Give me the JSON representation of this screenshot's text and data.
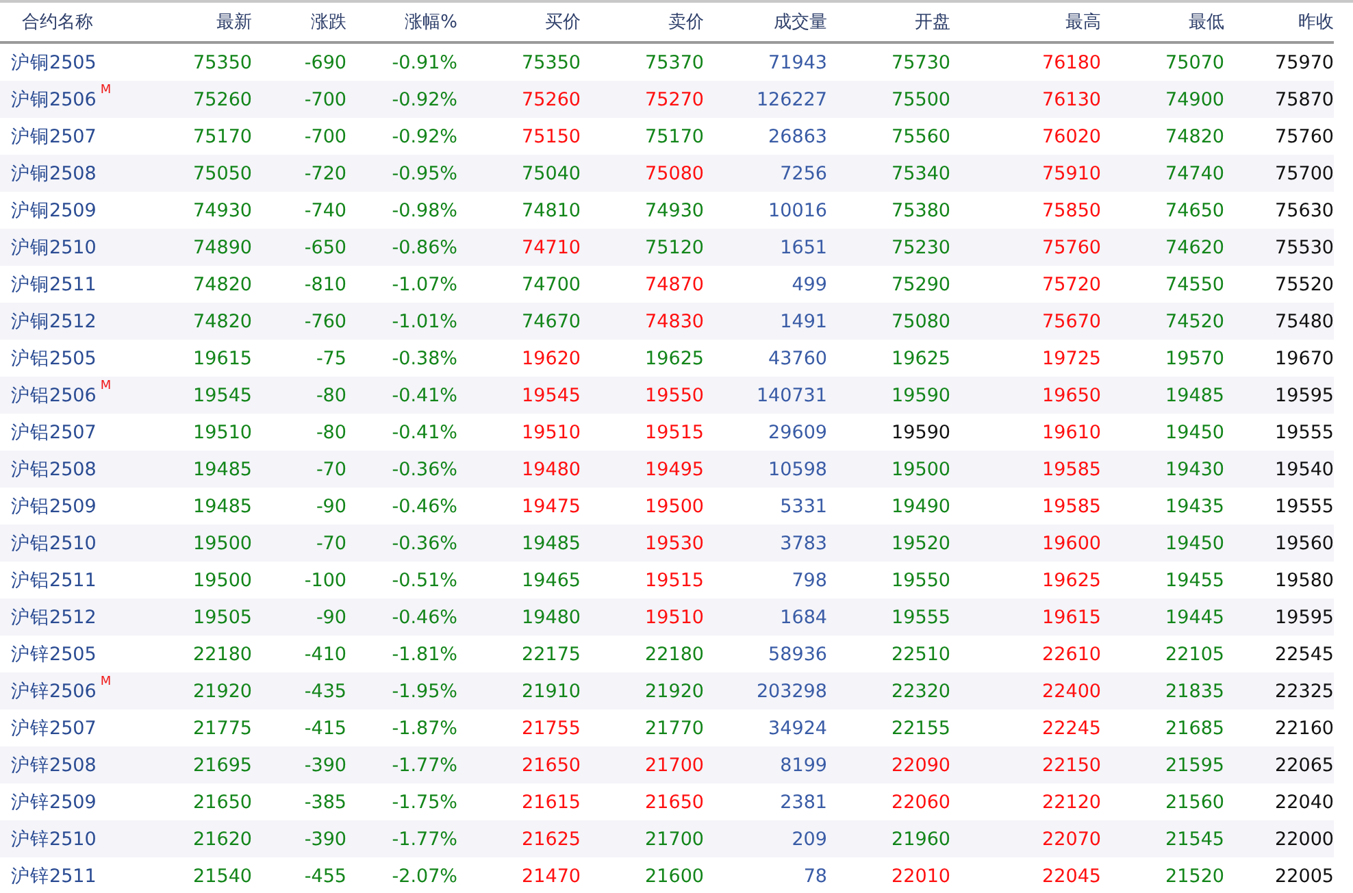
{
  "columns": [
    "合约名称",
    "最新",
    "涨跌",
    "涨幅%",
    "买价",
    "卖价",
    "成交量",
    "开盘",
    "最高",
    "最低",
    "昨收"
  ],
  "rows": [
    {
      "contract": "沪铜2505",
      "last": {
        "text": "75350",
        "color": "#13851a"
      },
      "change": {
        "text": "-690",
        "color": "#13851a"
      },
      "change_pct": {
        "text": "-0.91%",
        "color": "#13851a"
      },
      "bid": {
        "text": "75350",
        "color": "#13851a"
      },
      "ask": {
        "text": "75370",
        "color": "#13851a"
      },
      "volume": "71943",
      "open": {
        "text": "75730",
        "color": "#13851a"
      },
      "high": {
        "text": "76180",
        "color": "#ff1010"
      },
      "low": {
        "text": "75070",
        "color": "#13851a"
      },
      "prev_close": "75970"
    },
    {
      "contract": "沪铜2506",
      "badge": "M",
      "last": {
        "text": "75260",
        "color": "#13851a"
      },
      "change": {
        "text": "-700",
        "color": "#13851a"
      },
      "change_pct": {
        "text": "-0.92%",
        "color": "#13851a"
      },
      "bid": {
        "text": "75260",
        "color": "#ff1010"
      },
      "ask": {
        "text": "75270",
        "color": "#ff1010"
      },
      "volume": "126227",
      "open": {
        "text": "75500",
        "color": "#13851a"
      },
      "high": {
        "text": "76130",
        "color": "#ff1010"
      },
      "low": {
        "text": "74900",
        "color": "#13851a"
      },
      "prev_close": "75870"
    },
    {
      "contract": "沪铜2507",
      "last": {
        "text": "75170",
        "color": "#13851a"
      },
      "change": {
        "text": "-700",
        "color": "#13851a"
      },
      "change_pct": {
        "text": "-0.92%",
        "color": "#13851a"
      },
      "bid": {
        "text": "75150",
        "color": "#ff1010"
      },
      "ask": {
        "text": "75170",
        "color": "#13851a"
      },
      "volume": "26863",
      "open": {
        "text": "75560",
        "color": "#13851a"
      },
      "high": {
        "text": "76020",
        "color": "#ff1010"
      },
      "low": {
        "text": "74820",
        "color": "#13851a"
      },
      "prev_close": "75760"
    },
    {
      "contract": "沪铜2508",
      "last": {
        "text": "75050",
        "color": "#13851a"
      },
      "change": {
        "text": "-720",
        "color": "#13851a"
      },
      "change_pct": {
        "text": "-0.95%",
        "color": "#13851a"
      },
      "bid": {
        "text": "75040",
        "color": "#13851a"
      },
      "ask": {
        "text": "75080",
        "color": "#ff1010"
      },
      "volume": "7256",
      "open": {
        "text": "75340",
        "color": "#13851a"
      },
      "high": {
        "text": "75910",
        "color": "#ff1010"
      },
      "low": {
        "text": "74740",
        "color": "#13851a"
      },
      "prev_close": "75700"
    },
    {
      "contract": "沪铜2509",
      "last": {
        "text": "74930",
        "color": "#13851a"
      },
      "change": {
        "text": "-740",
        "color": "#13851a"
      },
      "change_pct": {
        "text": "-0.98%",
        "color": "#13851a"
      },
      "bid": {
        "text": "74810",
        "color": "#13851a"
      },
      "ask": {
        "text": "74930",
        "color": "#13851a"
      },
      "volume": "10016",
      "open": {
        "text": "75380",
        "color": "#13851a"
      },
      "high": {
        "text": "75850",
        "color": "#ff1010"
      },
      "low": {
        "text": "74650",
        "color": "#13851a"
      },
      "prev_close": "75630"
    },
    {
      "contract": "沪铜2510",
      "last": {
        "text": "74890",
        "color": "#13851a"
      },
      "change": {
        "text": "-650",
        "color": "#13851a"
      },
      "change_pct": {
        "text": "-0.86%",
        "color": "#13851a"
      },
      "bid": {
        "text": "74710",
        "color": "#ff1010"
      },
      "ask": {
        "text": "75120",
        "color": "#13851a"
      },
      "volume": "1651",
      "open": {
        "text": "75230",
        "color": "#13851a"
      },
      "high": {
        "text": "75760",
        "color": "#ff1010"
      },
      "low": {
        "text": "74620",
        "color": "#13851a"
      },
      "prev_close": "75530"
    },
    {
      "contract": "沪铜2511",
      "last": {
        "text": "74820",
        "color": "#13851a"
      },
      "change": {
        "text": "-810",
        "color": "#13851a"
      },
      "change_pct": {
        "text": "-1.07%",
        "color": "#13851a"
      },
      "bid": {
        "text": "74700",
        "color": "#13851a"
      },
      "ask": {
        "text": "74870",
        "color": "#ff1010"
      },
      "volume": "499",
      "open": {
        "text": "75290",
        "color": "#13851a"
      },
      "high": {
        "text": "75720",
        "color": "#ff1010"
      },
      "low": {
        "text": "74550",
        "color": "#13851a"
      },
      "prev_close": "75520"
    },
    {
      "contract": "沪铜2512",
      "last": {
        "text": "74820",
        "color": "#13851a"
      },
      "change": {
        "text": "-760",
        "color": "#13851a"
      },
      "change_pct": {
        "text": "-1.01%",
        "color": "#13851a"
      },
      "bid": {
        "text": "74670",
        "color": "#13851a"
      },
      "ask": {
        "text": "74830",
        "color": "#ff1010"
      },
      "volume": "1491",
      "open": {
        "text": "75080",
        "color": "#13851a"
      },
      "high": {
        "text": "75670",
        "color": "#ff1010"
      },
      "low": {
        "text": "74520",
        "color": "#13851a"
      },
      "prev_close": "75480"
    },
    {
      "contract": "沪铝2505",
      "last": {
        "text": "19615",
        "color": "#13851a"
      },
      "change": {
        "text": "-75",
        "color": "#13851a"
      },
      "change_pct": {
        "text": "-0.38%",
        "color": "#13851a"
      },
      "bid": {
        "text": "19620",
        "color": "#ff1010"
      },
      "ask": {
        "text": "19625",
        "color": "#13851a"
      },
      "volume": "43760",
      "open": {
        "text": "19625",
        "color": "#13851a"
      },
      "high": {
        "text": "19725",
        "color": "#ff1010"
      },
      "low": {
        "text": "19570",
        "color": "#13851a"
      },
      "prev_close": "19670"
    },
    {
      "contract": "沪铝2506",
      "badge": "M",
      "last": {
        "text": "19545",
        "color": "#13851a"
      },
      "change": {
        "text": "-80",
        "color": "#13851a"
      },
      "change_pct": {
        "text": "-0.41%",
        "color": "#13851a"
      },
      "bid": {
        "text": "19545",
        "color": "#ff1010"
      },
      "ask": {
        "text": "19550",
        "color": "#ff1010"
      },
      "volume": "140731",
      "open": {
        "text": "19590",
        "color": "#13851a"
      },
      "high": {
        "text": "19650",
        "color": "#ff1010"
      },
      "low": {
        "text": "19485",
        "color": "#13851a"
      },
      "prev_close": "19595"
    },
    {
      "contract": "沪铝2507",
      "last": {
        "text": "19510",
        "color": "#13851a"
      },
      "change": {
        "text": "-80",
        "color": "#13851a"
      },
      "change_pct": {
        "text": "-0.41%",
        "color": "#13851a"
      },
      "bid": {
        "text": "19510",
        "color": "#ff1010"
      },
      "ask": {
        "text": "19515",
        "color": "#ff1010"
      },
      "volume": "29609",
      "open": {
        "text": "19590",
        "color": "#111111"
      },
      "high": {
        "text": "19610",
        "color": "#ff1010"
      },
      "low": {
        "text": "19450",
        "color": "#13851a"
      },
      "prev_close": "19555"
    },
    {
      "contract": "沪铝2508",
      "last": {
        "text": "19485",
        "color": "#13851a"
      },
      "change": {
        "text": "-70",
        "color": "#13851a"
      },
      "change_pct": {
        "text": "-0.36%",
        "color": "#13851a"
      },
      "bid": {
        "text": "19480",
        "color": "#ff1010"
      },
      "ask": {
        "text": "19495",
        "color": "#ff1010"
      },
      "volume": "10598",
      "open": {
        "text": "19500",
        "color": "#13851a"
      },
      "high": {
        "text": "19585",
        "color": "#ff1010"
      },
      "low": {
        "text": "19430",
        "color": "#13851a"
      },
      "prev_close": "19540"
    },
    {
      "contract": "沪铝2509",
      "last": {
        "text": "19485",
        "color": "#13851a"
      },
      "change": {
        "text": "-90",
        "color": "#13851a"
      },
      "change_pct": {
        "text": "-0.46%",
        "color": "#13851a"
      },
      "bid": {
        "text": "19475",
        "color": "#ff1010"
      },
      "ask": {
        "text": "19500",
        "color": "#ff1010"
      },
      "volume": "5331",
      "open": {
        "text": "19490",
        "color": "#13851a"
      },
      "high": {
        "text": "19585",
        "color": "#ff1010"
      },
      "low": {
        "text": "19435",
        "color": "#13851a"
      },
      "prev_close": "19555"
    },
    {
      "contract": "沪铝2510",
      "last": {
        "text": "19500",
        "color": "#13851a"
      },
      "change": {
        "text": "-70",
        "color": "#13851a"
      },
      "change_pct": {
        "text": "-0.36%",
        "color": "#13851a"
      },
      "bid": {
        "text": "19485",
        "color": "#13851a"
      },
      "ask": {
        "text": "19530",
        "color": "#ff1010"
      },
      "volume": "3783",
      "open": {
        "text": "19520",
        "color": "#13851a"
      },
      "high": {
        "text": "19600",
        "color": "#ff1010"
      },
      "low": {
        "text": "19450",
        "color": "#13851a"
      },
      "prev_close": "19560"
    },
    {
      "contract": "沪铝2511",
      "last": {
        "text": "19500",
        "color": "#13851a"
      },
      "change": {
        "text": "-100",
        "color": "#13851a"
      },
      "change_pct": {
        "text": "-0.51%",
        "color": "#13851a"
      },
      "bid": {
        "text": "19465",
        "color": "#13851a"
      },
      "ask": {
        "text": "19515",
        "color": "#ff1010"
      },
      "volume": "798",
      "open": {
        "text": "19550",
        "color": "#13851a"
      },
      "high": {
        "text": "19625",
        "color": "#ff1010"
      },
      "low": {
        "text": "19455",
        "color": "#13851a"
      },
      "prev_close": "19580"
    },
    {
      "contract": "沪铝2512",
      "last": {
        "text": "19505",
        "color": "#13851a"
      },
      "change": {
        "text": "-90",
        "color": "#13851a"
      },
      "change_pct": {
        "text": "-0.46%",
        "color": "#13851a"
      },
      "bid": {
        "text": "19480",
        "color": "#13851a"
      },
      "ask": {
        "text": "19510",
        "color": "#ff1010"
      },
      "volume": "1684",
      "open": {
        "text": "19555",
        "color": "#13851a"
      },
      "high": {
        "text": "19615",
        "color": "#ff1010"
      },
      "low": {
        "text": "19445",
        "color": "#13851a"
      },
      "prev_close": "19595"
    },
    {
      "contract": "沪锌2505",
      "last": {
        "text": "22180",
        "color": "#13851a"
      },
      "change": {
        "text": "-410",
        "color": "#13851a"
      },
      "change_pct": {
        "text": "-1.81%",
        "color": "#13851a"
      },
      "bid": {
        "text": "22175",
        "color": "#13851a"
      },
      "ask": {
        "text": "22180",
        "color": "#13851a"
      },
      "volume": "58936",
      "open": {
        "text": "22510",
        "color": "#13851a"
      },
      "high": {
        "text": "22610",
        "color": "#ff1010"
      },
      "low": {
        "text": "22105",
        "color": "#13851a"
      },
      "prev_close": "22545"
    },
    {
      "contract": "沪锌2506",
      "badge": "M",
      "last": {
        "text": "21920",
        "color": "#13851a"
      },
      "change": {
        "text": "-435",
        "color": "#13851a"
      },
      "change_pct": {
        "text": "-1.95%",
        "color": "#13851a"
      },
      "bid": {
        "text": "21910",
        "color": "#13851a"
      },
      "ask": {
        "text": "21920",
        "color": "#13851a"
      },
      "volume": "203298",
      "open": {
        "text": "22320",
        "color": "#13851a"
      },
      "high": {
        "text": "22400",
        "color": "#ff1010"
      },
      "low": {
        "text": "21835",
        "color": "#13851a"
      },
      "prev_close": "22325"
    },
    {
      "contract": "沪锌2507",
      "last": {
        "text": "21775",
        "color": "#13851a"
      },
      "change": {
        "text": "-415",
        "color": "#13851a"
      },
      "change_pct": {
        "text": "-1.87%",
        "color": "#13851a"
      },
      "bid": {
        "text": "21755",
        "color": "#ff1010"
      },
      "ask": {
        "text": "21770",
        "color": "#13851a"
      },
      "volume": "34924",
      "open": {
        "text": "22155",
        "color": "#13851a"
      },
      "high": {
        "text": "22245",
        "color": "#ff1010"
      },
      "low": {
        "text": "21685",
        "color": "#13851a"
      },
      "prev_close": "22160"
    },
    {
      "contract": "沪锌2508",
      "last": {
        "text": "21695",
        "color": "#13851a"
      },
      "change": {
        "text": "-390",
        "color": "#13851a"
      },
      "change_pct": {
        "text": "-1.77%",
        "color": "#13851a"
      },
      "bid": {
        "text": "21650",
        "color": "#ff1010"
      },
      "ask": {
        "text": "21700",
        "color": "#ff1010"
      },
      "volume": "8199",
      "open": {
        "text": "22090",
        "color": "#ff1010"
      },
      "high": {
        "text": "22150",
        "color": "#ff1010"
      },
      "low": {
        "text": "21595",
        "color": "#13851a"
      },
      "prev_close": "22065"
    },
    {
      "contract": "沪锌2509",
      "last": {
        "text": "21650",
        "color": "#13851a"
      },
      "change": {
        "text": "-385",
        "color": "#13851a"
      },
      "change_pct": {
        "text": "-1.75%",
        "color": "#13851a"
      },
      "bid": {
        "text": "21615",
        "color": "#ff1010"
      },
      "ask": {
        "text": "21650",
        "color": "#ff1010"
      },
      "volume": "2381",
      "open": {
        "text": "22060",
        "color": "#ff1010"
      },
      "high": {
        "text": "22120",
        "color": "#ff1010"
      },
      "low": {
        "text": "21560",
        "color": "#13851a"
      },
      "prev_close": "22040"
    },
    {
      "contract": "沪锌2510",
      "last": {
        "text": "21620",
        "color": "#13851a"
      },
      "change": {
        "text": "-390",
        "color": "#13851a"
      },
      "change_pct": {
        "text": "-1.77%",
        "color": "#13851a"
      },
      "bid": {
        "text": "21625",
        "color": "#ff1010"
      },
      "ask": {
        "text": "21700",
        "color": "#13851a"
      },
      "volume": "209",
      "open": {
        "text": "21960",
        "color": "#13851a"
      },
      "high": {
        "text": "22070",
        "color": "#ff1010"
      },
      "low": {
        "text": "21545",
        "color": "#13851a"
      },
      "prev_close": "22000"
    },
    {
      "contract": "沪锌2511",
      "last": {
        "text": "21540",
        "color": "#13851a"
      },
      "change": {
        "text": "-455",
        "color": "#13851a"
      },
      "change_pct": {
        "text": "-2.07%",
        "color": "#13851a"
      },
      "bid": {
        "text": "21470",
        "color": "#ff1010"
      },
      "ask": {
        "text": "21600",
        "color": "#13851a"
      },
      "volume": "78",
      "open": {
        "text": "22010",
        "color": "#ff1010"
      },
      "high": {
        "text": "22045",
        "color": "#ff1010"
      },
      "low": {
        "text": "21520",
        "color": "#13851a"
      },
      "prev_close": "22005"
    }
  ]
}
